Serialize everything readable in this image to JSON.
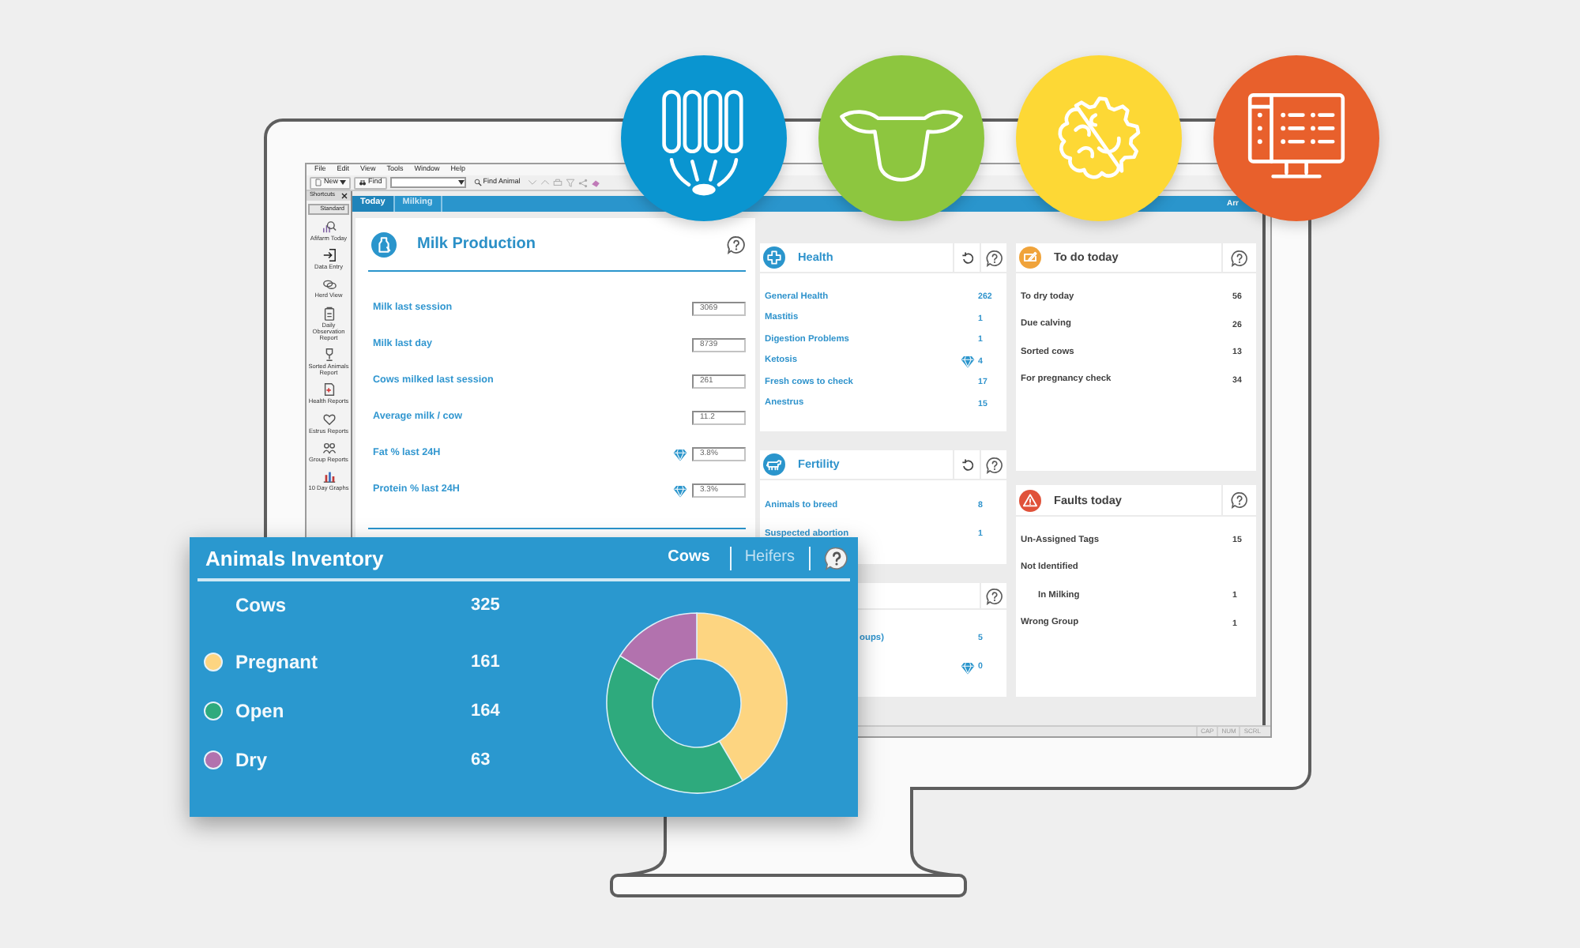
{
  "menu_bar": [
    "File",
    "Edit",
    "View",
    "Tools",
    "Window",
    "Help"
  ],
  "toolbar": {
    "new_button": "New",
    "find_button": "Find",
    "find_animal_button": "Find Animal"
  },
  "shortcuts": {
    "title": "Shortcuts",
    "group_button": "Standard",
    "items": [
      "Afifarm Today",
      "Data Entry",
      "Herd View",
      "Daily Observation Report",
      "Sorted Animals Report",
      "Health Reports",
      "Estrus Reports",
      "Group Reports",
      "10 Day Graphs"
    ]
  },
  "tabs": [
    {
      "label": "Today",
      "selected": true
    },
    {
      "label": "Milking",
      "selected": false
    }
  ],
  "tab_bar_text": "Arr",
  "milk_production": {
    "title": "Milk Production",
    "rows": [
      {
        "label": "Milk last session",
        "value": "3069",
        "kind": "plain"
      },
      {
        "label": "Milk last day",
        "value": "8739",
        "kind": "plain"
      },
      {
        "label": "Cows milked last session",
        "value": "261",
        "kind": "plain"
      },
      {
        "label": "Average milk / cow",
        "value": "11.2",
        "kind": "plain"
      },
      {
        "label": "Fat % last 24H",
        "value": "3.8%",
        "kind": "sensor"
      },
      {
        "label": "Protein % last 24H",
        "value": "3.3%",
        "kind": "sensor"
      }
    ]
  },
  "middle_panels": [
    {
      "kind": "health",
      "title": "Health",
      "rows": [
        {
          "label": "General Health",
          "value": "262",
          "kind": "plain"
        },
        {
          "label": "Mastitis",
          "value": "1",
          "kind": "plain"
        },
        {
          "label": "Digestion Problems",
          "value": "1",
          "kind": "plain"
        },
        {
          "label": "Ketosis",
          "value": "4",
          "kind": "sensor"
        },
        {
          "label": "Fresh cows to check",
          "value": "17",
          "kind": "plain"
        },
        {
          "label": "Anestrus",
          "value": "15",
          "kind": "plain"
        }
      ]
    },
    {
      "kind": "fertility",
      "title": "Fertility",
      "rows": [
        {
          "label": "Animals to breed",
          "value": "8",
          "kind": "plain"
        },
        {
          "label": "Suspected abortion",
          "value": "1",
          "kind": "plain"
        }
      ]
    },
    {
      "kind": "covered",
      "rows": [
        {
          "label": "oups)",
          "value": "5",
          "kind": "plain"
        },
        {
          "value": "0",
          "kind": "sensor"
        }
      ]
    }
  ],
  "right_panels": [
    {
      "kind": "todo",
      "title": "To do today",
      "rows": [
        {
          "label": "To dry today",
          "value": "56"
        },
        {
          "label": "Due calving",
          "value": "26"
        },
        {
          "label": "Sorted cows",
          "value": "13"
        },
        {
          "label": "For pregnancy check",
          "value": "34"
        }
      ]
    },
    {
      "kind": "faults",
      "title": "Faults today",
      "rows": [
        {
          "label": "Un-Assigned Tags",
          "value": "15"
        },
        {
          "label": "Not Identified",
          "children": [
            {
              "label": "In Milking",
              "value": "1"
            }
          ]
        },
        {
          "label": "Wrong Group",
          "value": "1"
        }
      ]
    }
  ],
  "status_bar": [
    "CAP",
    "NUM",
    "SCRL"
  ],
  "animals_inventory": {
    "title": "Animals Inventory",
    "tabs": [
      {
        "label": "Cows",
        "selected": true
      },
      {
        "label": "Heifers",
        "selected": false
      }
    ],
    "total": {
      "label": "Cows",
      "value": "325"
    },
    "rows": [
      {
        "label": "Pregnant",
        "value": "161",
        "color": "#fdd581"
      },
      {
        "label": "Open",
        "value": "164",
        "color": "#2eaa7d"
      },
      {
        "label": "Dry",
        "value": "63",
        "color": "#b272ae"
      }
    ],
    "chart_data": {
      "type": "donut",
      "values": [
        41.5,
        42.3,
        16.2
      ]
    }
  }
}
